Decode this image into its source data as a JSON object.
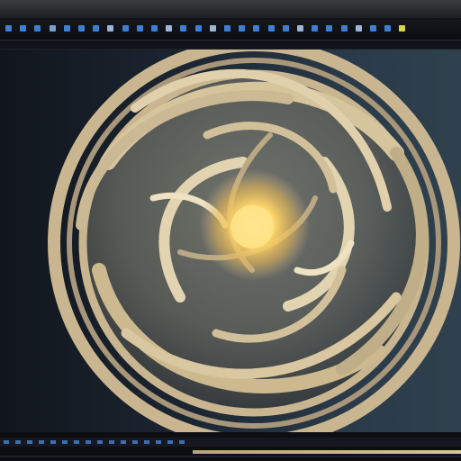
{
  "app": {
    "window": "3D viewport"
  },
  "toolbar": {
    "icons": [
      {
        "name": "tool-1-icon",
        "color": "#3f7fd0"
      },
      {
        "name": "tool-2-icon",
        "color": "#3f7fd0"
      },
      {
        "name": "tool-3-icon",
        "color": "#3f7fd0"
      },
      {
        "name": "tool-4-icon",
        "color": "#7aa0cc"
      },
      {
        "name": "tool-5-icon",
        "color": "#3f7fd0"
      },
      {
        "name": "tool-6-icon",
        "color": "#3f7fd0"
      },
      {
        "name": "tool-7-icon",
        "color": "#3f7fd0"
      },
      {
        "name": "tool-8-icon",
        "color": "#9fb6d4"
      },
      {
        "name": "tool-9-icon",
        "color": "#3f7fd0"
      },
      {
        "name": "tool-10-icon",
        "color": "#3f7fd0"
      },
      {
        "name": "tool-11-icon",
        "color": "#3f7fd0"
      },
      {
        "name": "tool-12-icon",
        "color": "#9fb6d4"
      },
      {
        "name": "tool-13-icon",
        "color": "#3f7fd0"
      },
      {
        "name": "tool-14-icon",
        "color": "#3f7fd0"
      },
      {
        "name": "tool-15-icon",
        "color": "#9fb6d4"
      },
      {
        "name": "tool-16-icon",
        "color": "#3f7fd0"
      },
      {
        "name": "tool-17-icon",
        "color": "#3f7fd0"
      },
      {
        "name": "tool-18-icon",
        "color": "#3f7fd0"
      },
      {
        "name": "tool-19-icon",
        "color": "#3f7fd0"
      },
      {
        "name": "tool-20-icon",
        "color": "#3f7fd0"
      },
      {
        "name": "tool-21-icon",
        "color": "#9fb6d4"
      },
      {
        "name": "tool-22-icon",
        "color": "#3f7fd0"
      },
      {
        "name": "tool-23-icon",
        "color": "#3f7fd0"
      },
      {
        "name": "tool-24-icon",
        "color": "#3f7fd0"
      },
      {
        "name": "tool-25-icon",
        "color": "#9fb6d4"
      },
      {
        "name": "tool-26-icon",
        "color": "#3f7fd0"
      },
      {
        "name": "tool-27-icon",
        "color": "#3f7fd0"
      },
      {
        "name": "tool-28-icon",
        "color": "#d8d44a"
      }
    ]
  },
  "viewport": {
    "object": "spiral-sphere-sculpture",
    "colors": {
      "bg_dark": "#11161d",
      "bg_light": "#30414e",
      "material": "#cbb894",
      "glow": "#ffd66a"
    }
  },
  "status": {
    "accent": "#3a6fb0",
    "timeline_color": "#cdb98f"
  }
}
